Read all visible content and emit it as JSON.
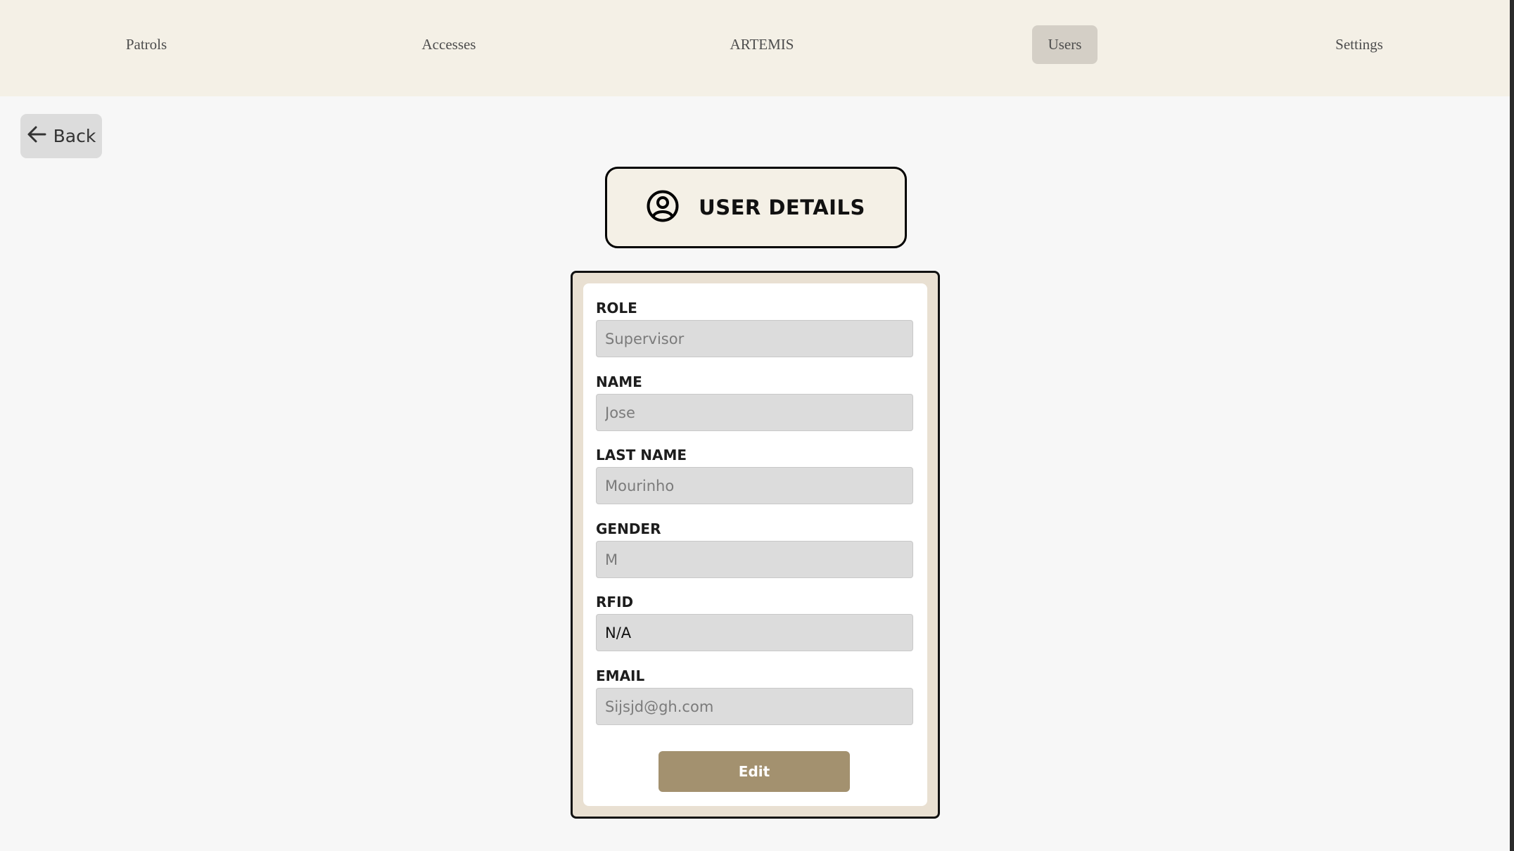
{
  "nav": {
    "items": [
      {
        "label": "Patrols"
      },
      {
        "label": "Accesses"
      },
      {
        "label": "ARTEMIS"
      },
      {
        "label": "Users",
        "active": true
      },
      {
        "label": "Settings"
      }
    ]
  },
  "back": {
    "label": "Back",
    "icon": "arrow-left-icon"
  },
  "header": {
    "title": "USER DETAILS",
    "icon": "user-circle-icon"
  },
  "form": {
    "role": {
      "label": "ROLE",
      "placeholder": "Supervisor",
      "value": ""
    },
    "name": {
      "label": "NAME",
      "placeholder": "Jose",
      "value": ""
    },
    "last_name": {
      "label": "LAST NAME",
      "placeholder": "Mourinho",
      "value": ""
    },
    "gender": {
      "label": "GENDER",
      "placeholder": "M",
      "value": ""
    },
    "rfid": {
      "label": "RFID",
      "placeholder": "",
      "value": "N/A"
    },
    "email": {
      "label": "EMAIL",
      "placeholder": "Sijsjd@gh.com",
      "value": ""
    },
    "edit_label": "Edit"
  },
  "colors": {
    "nav_bg": "#f4f0e6",
    "nav_active": "#d4cfc6",
    "card_border_bg": "#e9e0d2",
    "input_bg": "#dcdcdc",
    "edit_button": "#a3916f"
  }
}
